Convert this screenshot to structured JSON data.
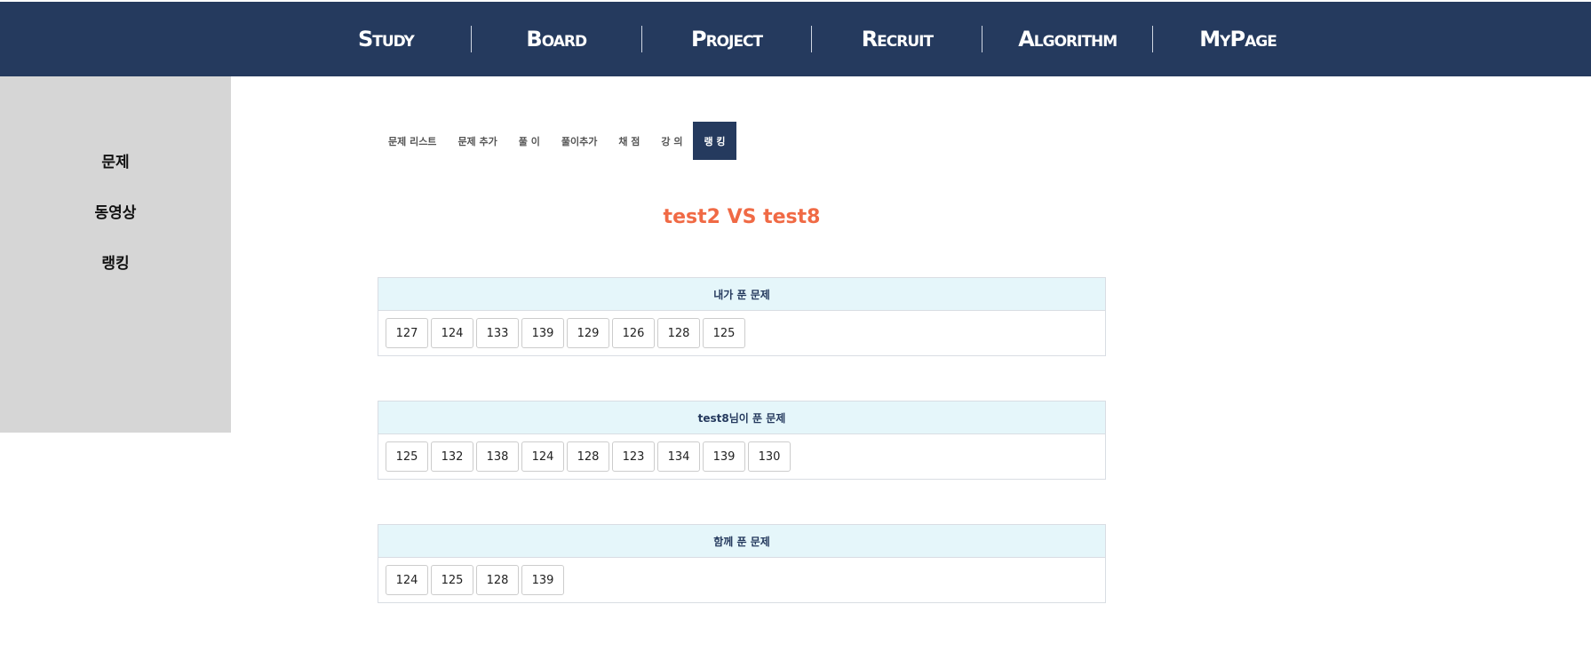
{
  "nav": {
    "items": [
      {
        "id": "study",
        "label": "Study"
      },
      {
        "id": "board",
        "label": "Board"
      },
      {
        "id": "project",
        "label": "Project"
      },
      {
        "id": "recruit",
        "label": "Recruit"
      },
      {
        "id": "algorithm",
        "label": "Algorithm"
      },
      {
        "id": "mypage",
        "label": "MyPage"
      }
    ]
  },
  "sidebar": {
    "items": [
      {
        "id": "problem",
        "label": "문제"
      },
      {
        "id": "video",
        "label": "동영상"
      },
      {
        "id": "ranking",
        "label": "랭킹"
      }
    ]
  },
  "tabs": {
    "items": [
      {
        "id": "problem-list",
        "label": "문제 리스트"
      },
      {
        "id": "problem-add",
        "label": "문제 추가"
      },
      {
        "id": "solution",
        "label": "풀 이"
      },
      {
        "id": "solution-add",
        "label": "풀이추가"
      },
      {
        "id": "grading",
        "label": "채 점"
      },
      {
        "id": "lecture",
        "label": "강 의"
      },
      {
        "id": "ranking",
        "label": "랭 킹"
      }
    ],
    "active": "ranking"
  },
  "comparison": {
    "title": "test2 VS test8",
    "panels": [
      {
        "id": "mine",
        "heading": "내가 푼 문제",
        "problems": [
          "127",
          "124",
          "133",
          "139",
          "129",
          "126",
          "128",
          "125"
        ]
      },
      {
        "id": "other",
        "heading": "test8님이 푼 문제",
        "problems": [
          "125",
          "132",
          "138",
          "124",
          "128",
          "123",
          "134",
          "139",
          "130"
        ]
      },
      {
        "id": "common",
        "heading": "함께 푼 문제",
        "problems": [
          "124",
          "125",
          "128",
          "139"
        ]
      }
    ]
  },
  "colors": {
    "nav_bg": "#253a5e",
    "accent": "#f06a45",
    "panel_head_bg": "#e5f6fa",
    "sidebar_bg": "#d6d6d6"
  }
}
